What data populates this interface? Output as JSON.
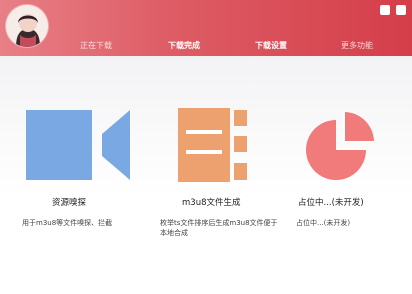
{
  "window": {
    "controls": [
      {
        "name": "minimize-button",
        "icon": "square-icon"
      },
      {
        "name": "close-button",
        "icon": "square-icon"
      }
    ]
  },
  "tabs": [
    {
      "label": "正在下载",
      "state": "inactive"
    },
    {
      "label": "下载完成",
      "state": "active"
    },
    {
      "label": "下载设置",
      "state": "active"
    },
    {
      "label": "更多功能",
      "state": "inactive"
    }
  ],
  "cards": [
    {
      "title": "资源嗅探",
      "description": "用于m3u8等文件嗅探、拦截",
      "icon": "video-camera-icon",
      "color": "#79a8e2"
    },
    {
      "title": "m3u8文件生成",
      "description": "枚举ts文件排序后生成m3u8文件便于本地合成",
      "icon": "document-list-icon",
      "color": "#eca16f"
    },
    {
      "title": "占位中...(未开发)",
      "description": "占位中...(未开发)",
      "icon": "pie-chart-icon",
      "color": "#f17b7b"
    }
  ],
  "colors": {
    "header_start": "#e87f86",
    "header_end": "#d43e49"
  }
}
